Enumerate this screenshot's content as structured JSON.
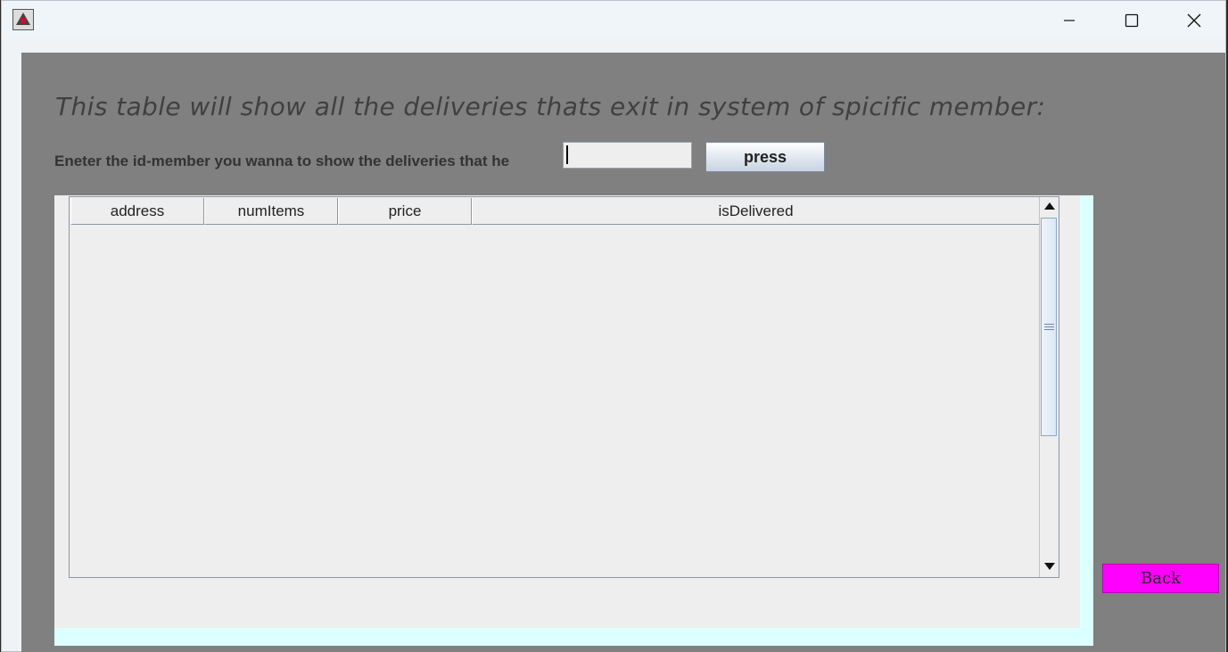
{
  "titlebar": {
    "icons": {
      "app": "java-app-icon",
      "minimize": "minimize-icon",
      "maximize": "maximize-icon",
      "close": "close-icon"
    }
  },
  "main": {
    "heading": "This table will show all the  deliveries thats exit in system of spicific member:",
    "prompt": "Eneter the id-member you wanna to show the deliveries that he",
    "id_input": {
      "value": "",
      "placeholder": ""
    },
    "press_label": "press",
    "back_label": "Back"
  },
  "table": {
    "columns": [
      "address",
      "numItems",
      "price",
      "isDelivered"
    ],
    "rows": []
  },
  "colors": {
    "content_background": "#808080",
    "back_button": "#ff00ff",
    "panel_border": "#dcffff"
  }
}
